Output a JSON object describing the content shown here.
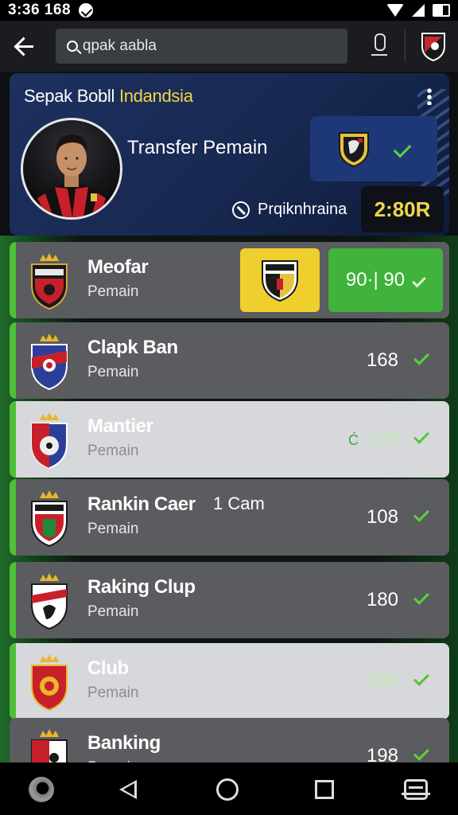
{
  "status_bar": {
    "time": "3:36 168"
  },
  "app_bar": {
    "search_value": "qpak aabla"
  },
  "hero": {
    "title_main": "Sepak Bobll ",
    "title_highlight": "Indandsia",
    "subtitle": "Transfer Pemain",
    "status_text": "Prqiknhraina",
    "timer": "2:80R",
    "accent_color": "#f1d54a"
  },
  "list": {
    "rows": [
      {
        "name": "Meofar",
        "role": "Pemain",
        "value": "90·| 90"
      },
      {
        "name": "Clapk Ban",
        "role": "Pemain",
        "value": "168"
      },
      {
        "name": "Mantier",
        "role": "Pemain",
        "value": "108",
        "lead": "Ć"
      },
      {
        "name": "Rankin Caer",
        "extra": "1 Cam",
        "role": "Pemain",
        "value": "108"
      },
      {
        "name": "Raking Clup",
        "role": "Pemain",
        "value": "180"
      },
      {
        "name": "Club",
        "role": "Pemain",
        "value": "106"
      },
      {
        "name": "Banking",
        "role": "Pemain",
        "value": "198"
      }
    ]
  },
  "colors": {
    "check_green": "#5bd23e",
    "row_bar_green": "#4fbf39",
    "hero_blue": "#1d3060"
  },
  "icons": [
    "back-arrow-icon",
    "search-icon",
    "mic-icon",
    "club-crest-icon",
    "more-vert-icon",
    "check-icon",
    "clock-icon",
    "nav-app-icon",
    "nav-back-icon",
    "nav-home-icon",
    "nav-recents-icon",
    "nav-keyboard-icon"
  ]
}
